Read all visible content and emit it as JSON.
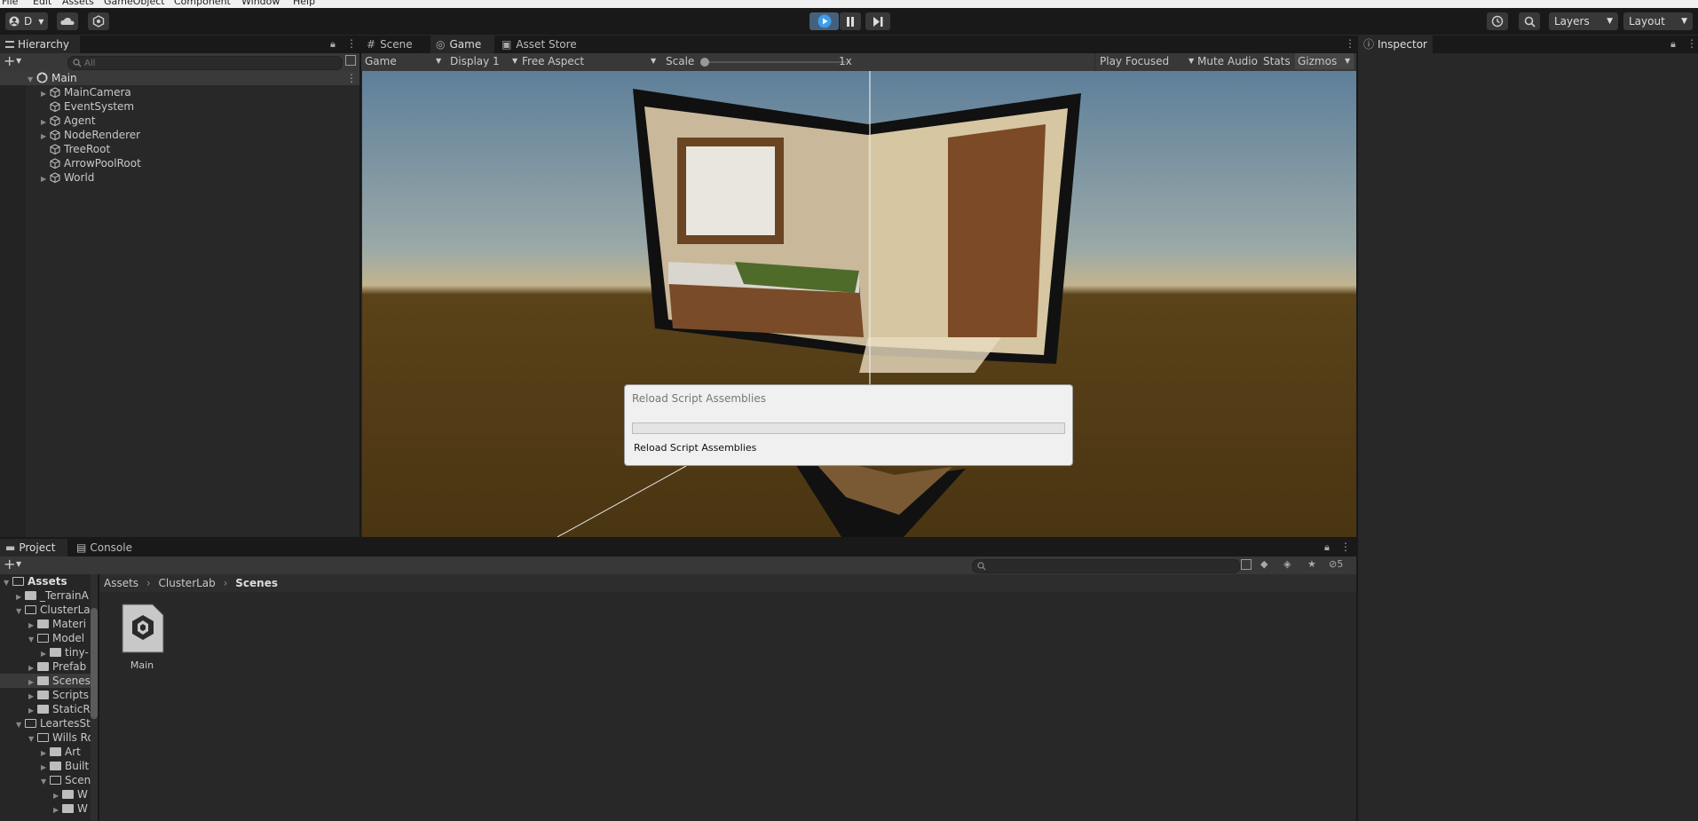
{
  "menu": [
    "File",
    "Edit",
    "Assets",
    "GameObject",
    "Component",
    "Window",
    "Help"
  ],
  "toolbar": {
    "account_label": "D",
    "layers_label": "Layers",
    "layout_label": "Layout"
  },
  "hierarchy": {
    "tab_label": "Hierarchy",
    "search_placeholder": "All",
    "scene_name": "Main",
    "items": [
      {
        "label": "MainCamera",
        "expandable": true
      },
      {
        "label": "EventSystem",
        "expandable": false
      },
      {
        "label": "Agent",
        "expandable": true
      },
      {
        "label": "NodeRenderer",
        "expandable": true
      },
      {
        "label": "TreeRoot",
        "expandable": false
      },
      {
        "label": "ArrowPoolRoot",
        "expandable": false
      },
      {
        "label": "World",
        "expandable": true
      }
    ]
  },
  "center_tabs": [
    "Scene",
    "Game",
    "Asset Store"
  ],
  "gamebar": {
    "mode": "Game",
    "display": "Display 1",
    "aspect": "Free Aspect",
    "scale_label": "Scale",
    "scale_value": "1x",
    "play_mode": "Play Focused",
    "mute": "Mute Audio",
    "stats": "Stats",
    "gizmos": "Gizmos"
  },
  "inspector": {
    "tab_label": "Inspector"
  },
  "dialog": {
    "title": "Reload Script Assemblies",
    "message": "Reload Script Assemblies",
    "progress": 0.0
  },
  "bottom_tabs": [
    "Project",
    "Console"
  ],
  "project": {
    "tree": [
      {
        "label": "Assets",
        "bold": true,
        "depth": 0,
        "open": true
      },
      {
        "label": "_TerrainA",
        "depth": 1,
        "open": false
      },
      {
        "label": "ClusterLa",
        "depth": 1,
        "open": true
      },
      {
        "label": "Materi",
        "depth": 2,
        "open": false
      },
      {
        "label": "Model",
        "depth": 2,
        "open": true
      },
      {
        "label": "tiny-",
        "depth": 3,
        "open": false
      },
      {
        "label": "Prefab",
        "depth": 2,
        "open": false
      },
      {
        "label": "Scenes",
        "depth": 2,
        "open": false,
        "selected": true
      },
      {
        "label": "Scripts",
        "depth": 2,
        "open": false
      },
      {
        "label": "StaticR",
        "depth": 2,
        "open": false
      },
      {
        "label": "LeartesSt",
        "depth": 1,
        "open": true
      },
      {
        "label": "Wills Ro",
        "depth": 2,
        "open": true
      },
      {
        "label": "Art",
        "depth": 3,
        "open": false
      },
      {
        "label": "Built",
        "depth": 3,
        "open": false
      },
      {
        "label": "Scen",
        "depth": 3,
        "open": true
      },
      {
        "label": "W",
        "depth": 4,
        "open": false
      },
      {
        "label": "W",
        "depth": 4,
        "open": false
      }
    ],
    "breadcrumb": [
      "Assets",
      "ClusterLab",
      "Scenes"
    ],
    "assets": [
      {
        "label": "Main"
      }
    ],
    "hidden_count": "5"
  }
}
